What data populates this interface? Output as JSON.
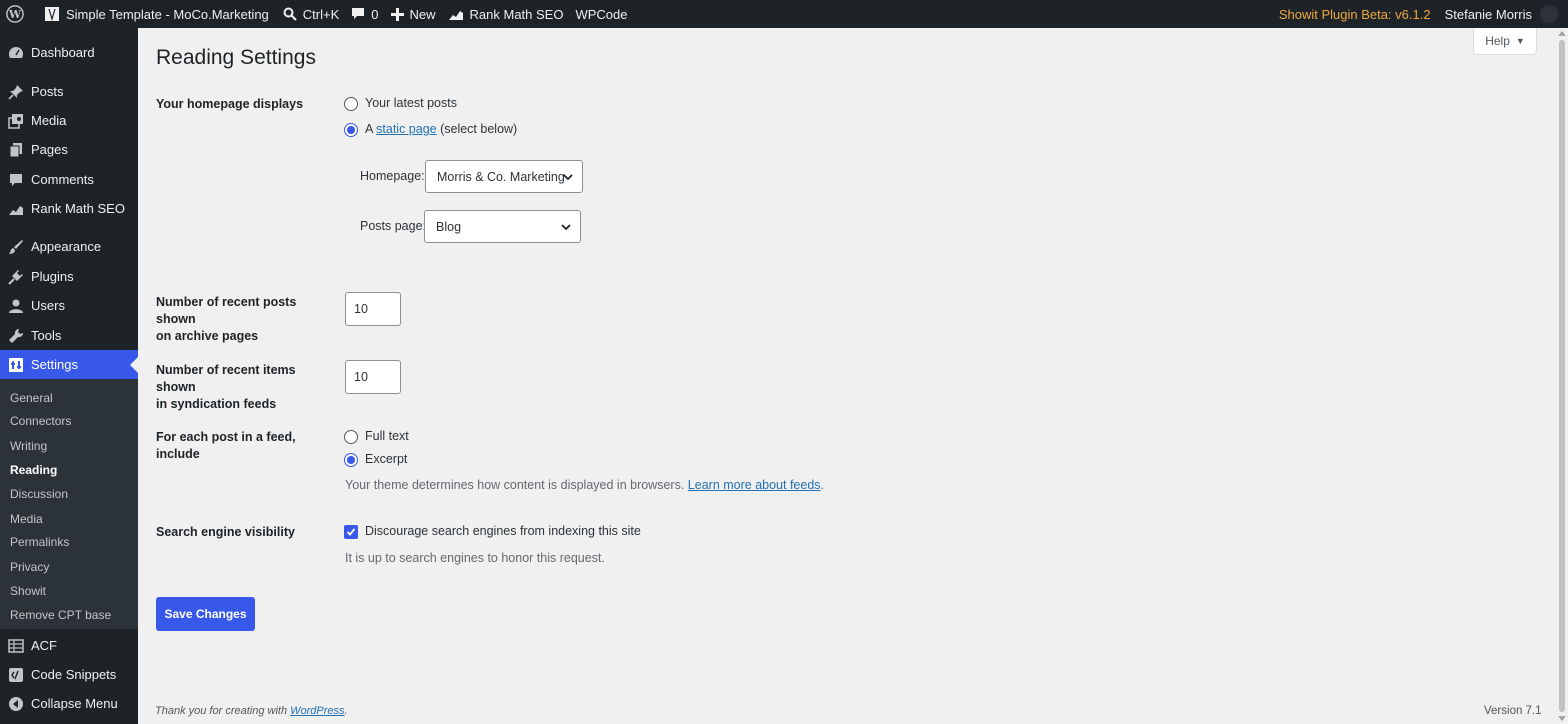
{
  "adminbar": {
    "site_name": "Simple Template - MoCo.Marketing",
    "search_shortcut": "Ctrl+K",
    "comments_count": "0",
    "new_label": "New",
    "rank_math": "Rank Math SEO",
    "wpcode": "WPCode",
    "showit_beta": "Showit Plugin Beta: v6.1.2",
    "user_name": "Stefanie Morris"
  },
  "sidebar": {
    "items": [
      {
        "label": "Dashboard",
        "icon": "dashboard-icon"
      },
      {
        "label": "Posts",
        "icon": "pin-icon"
      },
      {
        "label": "Media",
        "icon": "media-icon"
      },
      {
        "label": "Pages",
        "icon": "pages-icon"
      },
      {
        "label": "Comments",
        "icon": "comment-icon"
      },
      {
        "label": "Rank Math SEO",
        "icon": "rank-math-icon"
      },
      {
        "label": "Appearance",
        "icon": "brush-icon"
      },
      {
        "label": "Plugins",
        "icon": "plugin-icon"
      },
      {
        "label": "Users",
        "icon": "user-icon"
      },
      {
        "label": "Tools",
        "icon": "wrench-icon"
      },
      {
        "label": "Settings",
        "icon": "settings-icon"
      },
      {
        "label": "ACF",
        "icon": "acf-icon"
      },
      {
        "label": "Code Snippets",
        "icon": "code-icon"
      },
      {
        "label": "Collapse Menu",
        "icon": "collapse-icon"
      }
    ],
    "submenu": [
      "General",
      "Connectors",
      "Writing",
      "Reading",
      "Discussion",
      "Media",
      "Permalinks",
      "Privacy",
      "Showit",
      "Remove CPT base"
    ]
  },
  "header": {
    "help_label": "Help",
    "page_title": "Reading Settings"
  },
  "form": {
    "homepage_displays": {
      "label": "Your homepage displays",
      "option_latest": "Your latest posts",
      "option_static_prefix": "A",
      "option_static_link": "static page",
      "option_static_suffix": "(select below)",
      "homepage_label": "Homepage:",
      "homepage_value": "Morris & Co. Marketing",
      "posts_page_label": "Posts page:",
      "posts_page_value": "Blog"
    },
    "archive_posts": {
      "label_line1": "Number of recent posts shown",
      "label_line2": "on archive pages",
      "value": "10"
    },
    "syndication_items": {
      "label_line1": "Number of recent items shown",
      "label_line2": "in syndication feeds",
      "value": "10"
    },
    "feed_include": {
      "label": "For each post in a feed, include",
      "option_full": "Full text",
      "option_excerpt": "Excerpt",
      "desc_prefix": "Your theme determines how content is displayed in browsers.",
      "desc_link": "Learn more about feeds",
      "desc_suffix": "."
    },
    "search_visibility": {
      "label": "Search engine visibility",
      "checkbox_label": "Discourage search engines from indexing this site",
      "desc": "It is up to search engines to honor this request."
    },
    "save_label": "Save Changes"
  },
  "footer": {
    "thanks_prefix": "Thank you for creating with",
    "thanks_link": "WordPress",
    "thanks_suffix": ".",
    "version": "Version 7.1"
  },
  "colors": {
    "accent": "#3858e9",
    "adminbar_bg": "#1d2327",
    "beta_text": "#f0a940",
    "link": "#2271b1"
  }
}
